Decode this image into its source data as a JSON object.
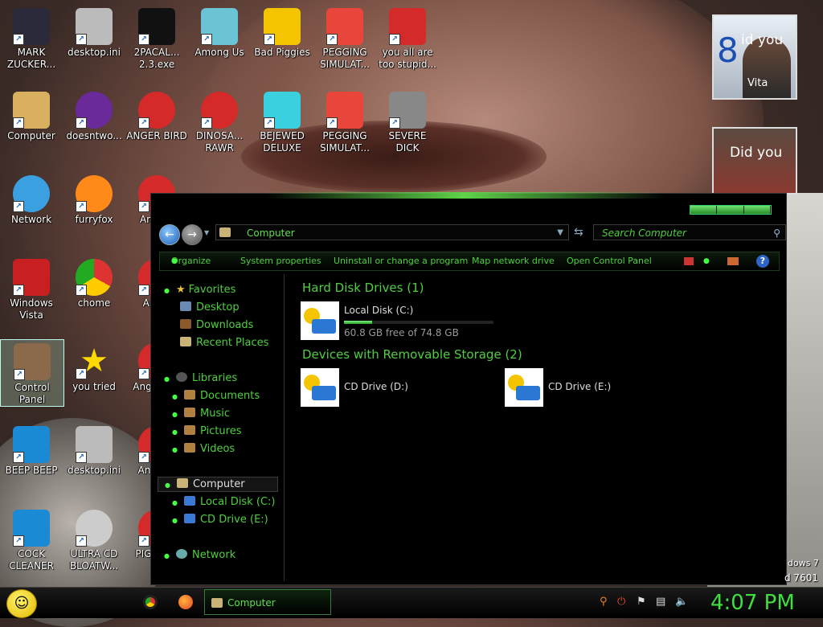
{
  "desktop_icons": [
    {
      "label": "MARK ZUCKER...",
      "icon": "mark-zuckerberg-icon"
    },
    {
      "label": "desktop.ini",
      "icon": "ini-file-icon"
    },
    {
      "label": "2PACAL... 2.3.exe",
      "icon": "console-app-icon"
    },
    {
      "label": "Among Us",
      "icon": "among-us-icon"
    },
    {
      "label": "Bad Piggies",
      "icon": "bad-piggies-icon"
    },
    {
      "label": "PEGGING SIMULAT...",
      "icon": "pegging-p-icon"
    },
    {
      "label": "you all are too stupid...",
      "icon": "dev-cpp-icon"
    },
    {
      "label": "Computer",
      "icon": "computer-icon"
    },
    {
      "label": "doesntwo...",
      "icon": "yahoo-messenger-icon"
    },
    {
      "label": "ANGER BIRD",
      "icon": "angry-bird-icon"
    },
    {
      "label": "DINOSA... RAWR",
      "icon": "angry-bird-icon"
    },
    {
      "label": "BEJEWED DELUXE",
      "icon": "bejeweled-icon"
    },
    {
      "label": "PEGGING SIMULAT...",
      "icon": "pegging-p-icon"
    },
    {
      "label": "SEVERE DICK",
      "icon": "sd-gear-icon"
    },
    {
      "label": "Network",
      "icon": "network-globe-icon"
    },
    {
      "label": "furryfox",
      "icon": "firefox-icon"
    },
    {
      "label": "Ang Se",
      "icon": "angry-bird-icon"
    },
    {
      "label": "Windows Vista",
      "icon": "recycle-bin-icon"
    },
    {
      "label": "chome",
      "icon": "chrome-icon"
    },
    {
      "label": "Ang S",
      "icon": "angry-bird-icon"
    },
    {
      "label": "Control Panel",
      "icon": "control-panel-icon"
    },
    {
      "label": "you tried",
      "icon": "star-icon"
    },
    {
      "label": "Angu Star",
      "icon": "angry-bird-icon"
    },
    {
      "label": "BEEP BEEP",
      "icon": "blue-book-icon"
    },
    {
      "label": "desktop.ini",
      "icon": "ini-file-icon"
    },
    {
      "label": "Ang Sta",
      "icon": "angry-bird-icon"
    },
    {
      "label": "COCK CLEANER",
      "icon": "blue-book-icon"
    },
    {
      "label": "ULTRA CD BLOATW...",
      "icon": "cd-icon"
    },
    {
      "label": "PIG BIRD",
      "icon": "angry-bird-icon"
    }
  ],
  "gadgets": {
    "top_text": "id you",
    "top_text2": "Vita",
    "top_digit": "8",
    "bottom_text": "Did you"
  },
  "explorer": {
    "address": "Computer",
    "search_placeholder": "Search Computer",
    "commands": {
      "organize": "Organize",
      "system_properties": "System properties",
      "uninstall": "Uninstall or change a program",
      "map_drive": "Map network drive",
      "control_panel": "Open Control Panel",
      "help": "?"
    },
    "nav": {
      "favorites": "Favorites",
      "desktop": "Desktop",
      "downloads": "Downloads",
      "recent": "Recent Places",
      "libraries": "Libraries",
      "documents": "Documents",
      "music": "Music",
      "pictures": "Pictures",
      "videos": "Videos",
      "computer": "Computer",
      "local_disk": "Local Disk (C:)",
      "cd_drive": "CD Drive (E:)",
      "network": "Network"
    },
    "groups": {
      "hdd": "Hard Disk Drives (1)",
      "removable": "Devices with Removable Storage (2)"
    },
    "drives": {
      "c": {
        "name": "Local Disk (C:)",
        "free": "60.8 GB free of 74.8 GB",
        "used_fraction": 0.19
      },
      "d": {
        "name": "CD Drive (D:)"
      },
      "e": {
        "name": "CD Drive (E:)"
      }
    }
  },
  "taskbar": {
    "task_label": "Computer",
    "clock": "4:07 PM"
  },
  "watermark": {
    "line1": "dows 7",
    "line2": "d 7601"
  },
  "colors": {
    "accent_green": "#4fcf3f",
    "clock_green": "#3fe03f"
  }
}
